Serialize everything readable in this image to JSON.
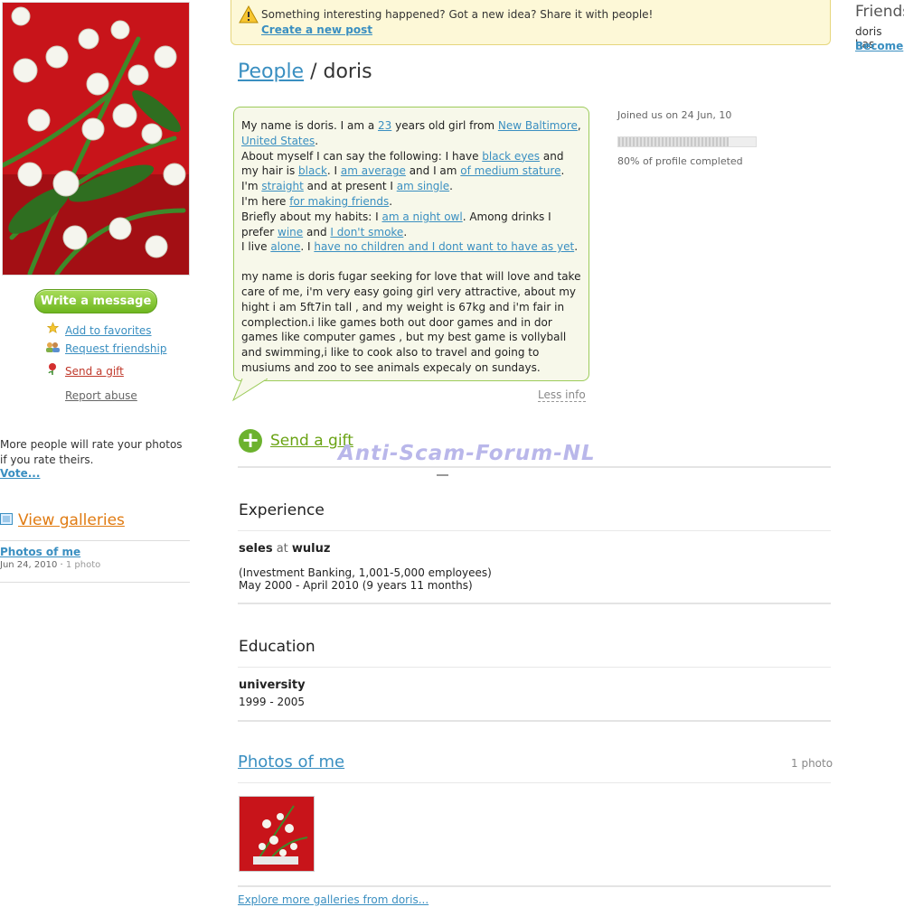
{
  "notice": {
    "text": "Something interesting happened? Got a new idea? Share it with people!",
    "link": "Create a new post"
  },
  "breadcrumb": {
    "parent": "People",
    "separator": " / ",
    "current": "doris"
  },
  "sidebar": {
    "write_message": "Write a message",
    "actions": {
      "favorites": "Add to favorites",
      "friendship": "Request friendship",
      "gift": "Send a gift"
    },
    "report": "Report abuse",
    "rate_text": "More people will rate your photos if you rate theirs.",
    "vote": "Vote...",
    "view_galleries": "View galleries",
    "gallery": {
      "title": "Photos of me",
      "date": "Jun 24, 2010",
      "separator": " · ",
      "count": "1 photo"
    }
  },
  "bio": {
    "l1a": "My name is doris. I am a ",
    "age": "23",
    "l1b": " years old girl from ",
    "city": "New Baltimore",
    "comma": ",",
    "country": "United States",
    "period1": ".",
    "l2a": "About myself I can say the following: I have ",
    "eyes": "black eyes",
    "l2b": " and my hair is ",
    "hair": "black",
    "l2c": ". I ",
    "build": "am average",
    "l2d": " and I am ",
    "stature": "of medium stature",
    "period2": ".",
    "l3a": "I'm ",
    "orientation": "straight",
    "l3b": " and at present I ",
    "status": "am single",
    "period3": ".",
    "l4a": "I'm here ",
    "purpose": "for making friends",
    "period4": ".",
    "l5a": "Briefly about my habits: I ",
    "habit": "am a night owl",
    "l5b": ". Among drinks I prefer ",
    "drink": "wine",
    "l5c": " and ",
    "smoke": "I don't smoke",
    "period5": ".",
    "l6a": "I live ",
    "live": "alone",
    "l6b": ". I ",
    "children": "have no children and I dont want to have as yet",
    "period6": ".",
    "about": "my name is doris fugar seeking for love that will love and take care of me, i'm very easy going girl very attractive, about my hight i am 5ft7in tall , and my weight is 67kg and i'm fair in complection.i like games both out door games and in dor games like computer games , but my best game is vollyball and swimming,i like to cook also to travel and going to musiums and zoo to see animals expecaly on sundays.",
    "less_info": "Less info"
  },
  "profile": {
    "joined": "Joined us on 24 Jun, 10",
    "completed_pct": 80,
    "completed_text": "80% of profile completed"
  },
  "gift_section": {
    "label": "Send a gift"
  },
  "watermark": "Anti-Scam-Forum-NL",
  "experience": {
    "title": "Experience",
    "job_title": "seles",
    "at": " at ",
    "company": "wuluz",
    "detail1": "(Investment Banking, 1,001-5,000 employees)",
    "detail2": "May 2000 - April 2010 (9 years 11 months)"
  },
  "education": {
    "title": "Education",
    "school": "university",
    "years": "1999 - 2005"
  },
  "photos": {
    "title": "Photos of me",
    "count": "1 photo",
    "explore": "Explore more galleries from doris..."
  },
  "friends": {
    "title": "Friends",
    "text": "doris has",
    "become": "Become"
  },
  "colors": {
    "link": "#3a8fc1",
    "green": "#6cb22e",
    "orange": "#e07b12",
    "bubble_border": "#9ccb5a"
  }
}
